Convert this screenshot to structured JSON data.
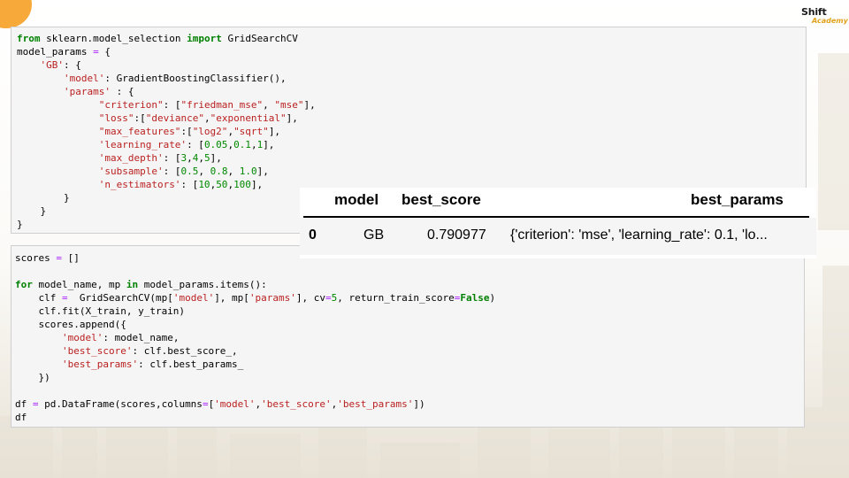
{
  "logo": {
    "line1": "Shift",
    "line2": "Academy"
  },
  "cell1": {
    "lines": [
      [
        {
          "t": "from",
          "c": "kw"
        },
        {
          "t": " sklearn.model_selection "
        },
        {
          "t": "import",
          "c": "kw"
        },
        {
          "t": " GridSearchCV"
        }
      ],
      [
        {
          "t": "model_params "
        },
        {
          "t": "=",
          "c": "op"
        },
        {
          "t": " {"
        }
      ],
      [
        {
          "t": "    "
        },
        {
          "t": "'GB'",
          "c": "str"
        },
        {
          "t": ": {"
        }
      ],
      [
        {
          "t": "        "
        },
        {
          "t": "'model'",
          "c": "str"
        },
        {
          "t": ": GradientBoostingClassifier(),"
        }
      ],
      [
        {
          "t": "        "
        },
        {
          "t": "'params'",
          "c": "str"
        },
        {
          "t": " : {"
        }
      ],
      [
        {
          "t": "              "
        },
        {
          "t": "\"criterion\"",
          "c": "str"
        },
        {
          "t": ": ["
        },
        {
          "t": "\"friedman_mse\"",
          "c": "str"
        },
        {
          "t": ", "
        },
        {
          "t": "\"mse\"",
          "c": "str"
        },
        {
          "t": "],"
        }
      ],
      [
        {
          "t": "              "
        },
        {
          "t": "\"loss\"",
          "c": "str"
        },
        {
          "t": ":["
        },
        {
          "t": "\"deviance\"",
          "c": "str"
        },
        {
          "t": ","
        },
        {
          "t": "\"exponential\"",
          "c": "str"
        },
        {
          "t": "],"
        }
      ],
      [
        {
          "t": "              "
        },
        {
          "t": "\"max_features\"",
          "c": "str"
        },
        {
          "t": ":["
        },
        {
          "t": "\"log2\"",
          "c": "str"
        },
        {
          "t": ","
        },
        {
          "t": "\"sqrt\"",
          "c": "str"
        },
        {
          "t": "],"
        }
      ],
      [
        {
          "t": "              "
        },
        {
          "t": "'learning_rate'",
          "c": "str"
        },
        {
          "t": ": ["
        },
        {
          "t": "0.05",
          "c": "num"
        },
        {
          "t": ","
        },
        {
          "t": "0.1",
          "c": "num"
        },
        {
          "t": ","
        },
        {
          "t": "1",
          "c": "num"
        },
        {
          "t": "],"
        }
      ],
      [
        {
          "t": "              "
        },
        {
          "t": "'max_depth'",
          "c": "str"
        },
        {
          "t": ": ["
        },
        {
          "t": "3",
          "c": "num"
        },
        {
          "t": ","
        },
        {
          "t": "4",
          "c": "num"
        },
        {
          "t": ","
        },
        {
          "t": "5",
          "c": "num"
        },
        {
          "t": "],"
        }
      ],
      [
        {
          "t": "              "
        },
        {
          "t": "'subsample'",
          "c": "str"
        },
        {
          "t": ": ["
        },
        {
          "t": "0.5",
          "c": "num"
        },
        {
          "t": ", "
        },
        {
          "t": "0.8",
          "c": "num"
        },
        {
          "t": ", "
        },
        {
          "t": "1.0",
          "c": "num"
        },
        {
          "t": "],"
        }
      ],
      [
        {
          "t": "              "
        },
        {
          "t": "'n_estimators'",
          "c": "str"
        },
        {
          "t": ": ["
        },
        {
          "t": "10",
          "c": "num"
        },
        {
          "t": ","
        },
        {
          "t": "50",
          "c": "num"
        },
        {
          "t": ","
        },
        {
          "t": "100",
          "c": "num"
        },
        {
          "t": "],"
        }
      ],
      [
        {
          "t": "        }"
        }
      ],
      [
        {
          "t": "    }"
        }
      ],
      [
        {
          "t": "}"
        }
      ]
    ]
  },
  "cell2": {
    "lines": [
      [
        {
          "t": "scores "
        },
        {
          "t": "=",
          "c": "op"
        },
        {
          "t": " []"
        }
      ],
      [
        {
          "t": ""
        }
      ],
      [
        {
          "t": "for",
          "c": "kw"
        },
        {
          "t": " model_name, mp "
        },
        {
          "t": "in",
          "c": "kw"
        },
        {
          "t": " model_params.items():"
        }
      ],
      [
        {
          "t": "    clf "
        },
        {
          "t": "=",
          "c": "op"
        },
        {
          "t": "  GridSearchCV(mp["
        },
        {
          "t": "'model'",
          "c": "str"
        },
        {
          "t": "], mp["
        },
        {
          "t": "'params'",
          "c": "str"
        },
        {
          "t": "], cv"
        },
        {
          "t": "=",
          "c": "op"
        },
        {
          "t": "5",
          "c": "num"
        },
        {
          "t": ", return_train_score"
        },
        {
          "t": "=",
          "c": "op"
        },
        {
          "t": "False",
          "c": "cst"
        },
        {
          "t": ")"
        }
      ],
      [
        {
          "t": "    clf.fit(X_train, y_train)"
        }
      ],
      [
        {
          "t": "    scores.append({"
        }
      ],
      [
        {
          "t": "        "
        },
        {
          "t": "'model'",
          "c": "str"
        },
        {
          "t": ": model_name,"
        }
      ],
      [
        {
          "t": "        "
        },
        {
          "t": "'best_score'",
          "c": "str"
        },
        {
          "t": ": clf.best_score_,"
        }
      ],
      [
        {
          "t": "        "
        },
        {
          "t": "'best_params'",
          "c": "str"
        },
        {
          "t": ": clf.best_params_"
        }
      ],
      [
        {
          "t": "    })"
        }
      ],
      [
        {
          "t": ""
        }
      ],
      [
        {
          "t": "df "
        },
        {
          "t": "=",
          "c": "op"
        },
        {
          "t": " pd.DataFrame(scores,columns"
        },
        {
          "t": "=",
          "c": "op"
        },
        {
          "t": "["
        },
        {
          "t": "'model'",
          "c": "str"
        },
        {
          "t": ","
        },
        {
          "t": "'best_score'",
          "c": "str"
        },
        {
          "t": ","
        },
        {
          "t": "'best_params'",
          "c": "str"
        },
        {
          "t": "])"
        }
      ],
      [
        {
          "t": "df"
        }
      ]
    ]
  },
  "dataframe": {
    "columns": [
      "model",
      "best_score",
      "best_params"
    ],
    "rows": [
      {
        "index": "0",
        "model": "GB",
        "best_score": "0.790977",
        "best_params": "{'criterion': 'mse', 'learning_rate': 0.1, 'lo..."
      }
    ]
  }
}
